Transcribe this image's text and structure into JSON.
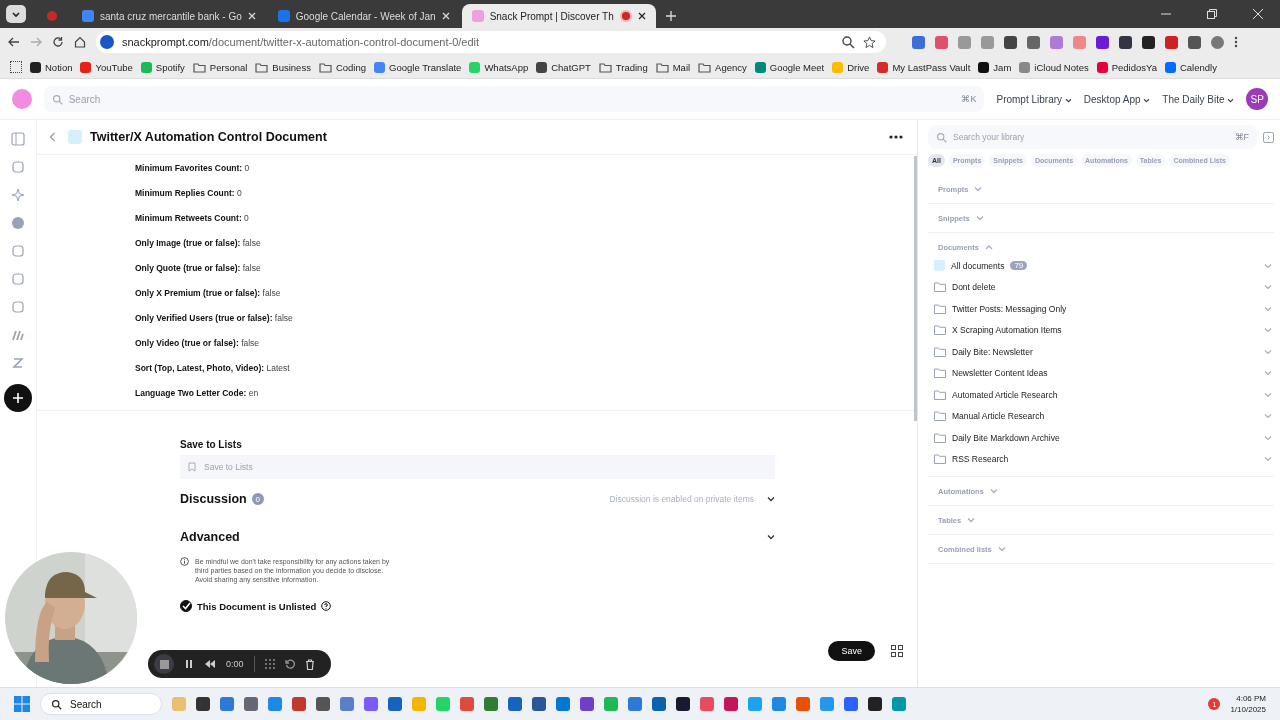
{
  "browser": {
    "tabs": [
      {
        "kind": "pinned",
        "selected": false
      },
      {
        "kind": "page",
        "title": "santa cruz mercantile bank - Go",
        "selected": false
      },
      {
        "kind": "page",
        "title": "Google Calendar - Week of Jan",
        "selected": false
      },
      {
        "kind": "page",
        "title": "Snack Prompt | Discover Th",
        "selected": true
      }
    ],
    "url": {
      "domain": "snackprompt.com",
      "path": "/document/twitter-x-automation-control-document-0/edit"
    },
    "bookmarks": [
      {
        "label": "Notion",
        "kind": "site",
        "color": "#222222"
      },
      {
        "label": "YouTube",
        "kind": "site",
        "color": "#e62117"
      },
      {
        "label": "Spotify",
        "kind": "site",
        "color": "#1db954"
      },
      {
        "label": "Personal",
        "kind": "folder"
      },
      {
        "label": "Business",
        "kind": "folder"
      },
      {
        "label": "Coding",
        "kind": "folder"
      },
      {
        "label": "Google Translate",
        "kind": "site",
        "color": "#4285f4"
      },
      {
        "label": "WhatsApp",
        "kind": "site",
        "color": "#25d366"
      },
      {
        "label": "ChatGPT",
        "kind": "site",
        "color": "#444444"
      },
      {
        "label": "Trading",
        "kind": "folder"
      },
      {
        "label": "Mail",
        "kind": "folder"
      },
      {
        "label": "Agency",
        "kind": "folder"
      },
      {
        "label": "Google Meet",
        "kind": "site",
        "color": "#00897b"
      },
      {
        "label": "Drive",
        "kind": "site",
        "color": "#fbbc04"
      },
      {
        "label": "My LastPass Vault",
        "kind": "site",
        "color": "#d32d27"
      },
      {
        "label": "Jam",
        "kind": "site",
        "color": "#111111"
      },
      {
        "label": "iCloud Notes",
        "kind": "site",
        "color": "#888888"
      },
      {
        "label": "PedidosYa",
        "kind": "site",
        "color": "#e4003b"
      },
      {
        "label": "Calendly",
        "kind": "site",
        "color": "#006bff"
      }
    ]
  },
  "header": {
    "search": {
      "placeholder": "Search",
      "shortcut": "⌘K"
    },
    "nav": [
      "Prompt Library",
      "Desktop App",
      "The Daily Bite"
    ],
    "avatar": "SP"
  },
  "document": {
    "title": "Twitter/X Automation Control Document",
    "fields": [
      {
        "label": "Minimum Favorites Count:",
        "value": "0"
      },
      {
        "label": "Minimum Replies Count:",
        "value": "0"
      },
      {
        "label": "Minimum Retweets Count:",
        "value": "0"
      },
      {
        "label": "Only Image (true or false):",
        "value": "false"
      },
      {
        "label": "Only Quote (true or false):",
        "value": "false"
      },
      {
        "label": "Only X Premium (true or false):",
        "value": "false"
      },
      {
        "label": "Only Verified Users (true or false):",
        "value": "false"
      },
      {
        "label": "Only Video (true or false):",
        "value": "false"
      },
      {
        "label": "Sort (Top, Latest, Photo, Video):",
        "value": "Latest"
      },
      {
        "label": "Language Two Letter Code:",
        "value": "en"
      }
    ],
    "save_to_lists": {
      "heading": "Save to Lists",
      "placeholder": "Save to Lists"
    },
    "discussion": {
      "heading": "Discussion",
      "count": "0",
      "note": "Discussion is enabled on private items",
      "expanded": false
    },
    "advanced": {
      "heading": "Advanced",
      "expanded": false
    },
    "disclaimer": "Be mindful we don't take responsibility for any actions taken by third parties based on the information you decide to disclose. Avoid sharing any sensitive information.",
    "unlisted": {
      "label": "This Document is Unlisted",
      "checked": true
    },
    "save_button": "Save"
  },
  "library": {
    "search": {
      "placeholder": "Search your library",
      "shortcut": "⌘F"
    },
    "filters": [
      {
        "label": "All",
        "selected": true
      },
      {
        "label": "Prompts",
        "selected": false
      },
      {
        "label": "Snippets",
        "selected": false
      },
      {
        "label": "Documents",
        "selected": false
      },
      {
        "label": "Automations",
        "selected": false
      },
      {
        "label": "Tables",
        "selected": false
      },
      {
        "label": "Combined Lists",
        "selected": false
      }
    ],
    "sections": [
      {
        "label": "Prompts",
        "expanded": false
      },
      {
        "label": "Snippets",
        "expanded": false
      },
      {
        "label": "Documents",
        "expanded": true,
        "children": [
          {
            "label": "All documents",
            "kind": "all",
            "count": "79"
          },
          {
            "label": "Dont delete",
            "kind": "folder"
          },
          {
            "label": "Twitter Posts: Messaging Only",
            "kind": "folder"
          },
          {
            "label": "X Scraping Automation Items",
            "kind": "folder"
          },
          {
            "label": "Daily Bite: Newsletter",
            "kind": "folder"
          },
          {
            "label": "Newsletter Content Ideas",
            "kind": "folder"
          },
          {
            "label": "Automated Article Research",
            "kind": "folder"
          },
          {
            "label": "Manual Article Research",
            "kind": "folder"
          },
          {
            "label": "Daily Bite Markdown Archive",
            "kind": "folder"
          },
          {
            "label": "RSS Research",
            "kind": "folder"
          }
        ]
      },
      {
        "label": "Automations",
        "expanded": false
      },
      {
        "label": "Tables",
        "expanded": false
      },
      {
        "label": "Combined lists",
        "expanded": false
      }
    ]
  },
  "recorder": {
    "time": "0:00"
  },
  "taskbar": {
    "search": "Search",
    "time": "4:06 PM",
    "date": "1/10/2025",
    "notifications": "1"
  }
}
